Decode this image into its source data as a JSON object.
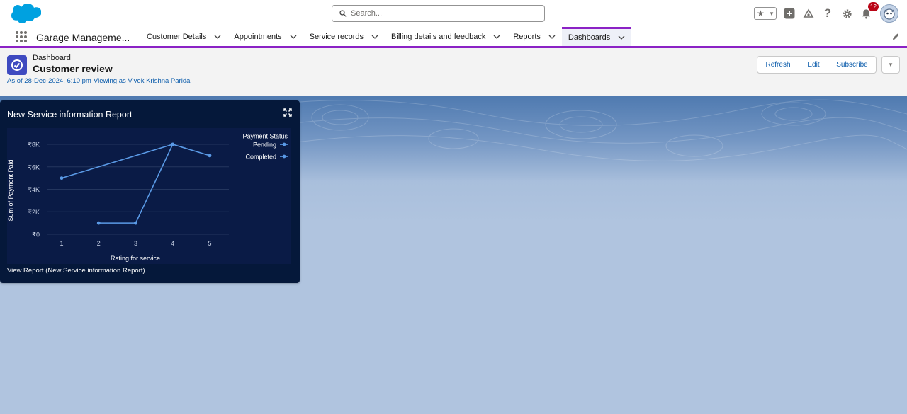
{
  "header": {
    "search_placeholder": "Search...",
    "notifications_count": "12"
  },
  "nav": {
    "app_name": "Garage Manageme...",
    "items": [
      {
        "label": "Customer Details"
      },
      {
        "label": "Appointments"
      },
      {
        "label": "Service records"
      },
      {
        "label": "Billing details and feedback"
      },
      {
        "label": "Reports"
      },
      {
        "label": "Dashboards"
      }
    ],
    "active_item": "Dashboards"
  },
  "page": {
    "object_type": "Dashboard",
    "title": "Customer review",
    "meta": "As of 28-Dec-2024, 6:10 pm·Viewing as Vivek Krishna Parida",
    "buttons": {
      "refresh": "Refresh",
      "edit": "Edit",
      "subscribe": "Subscribe"
    }
  },
  "widget": {
    "title": "New Service information Report",
    "view_report": "View Report (New Service information Report)"
  },
  "colors": {
    "brand_blue": "#00a1e0",
    "nav_accent": "#8b22c5",
    "link_blue": "#0b5cab",
    "widget_bg": "#05183a",
    "series_line": "#5a9ae6"
  },
  "chart_data": {
    "type": "line",
    "title": "New Service information Report",
    "xlabel": "Rating for service",
    "ylabel": "Sum of Payment Paid",
    "x": [
      1,
      2,
      3,
      4,
      5
    ],
    "y_ticks": [
      "₹0",
      "₹2K",
      "₹4K",
      "₹6K",
      "₹8K"
    ],
    "ylim": [
      0,
      8000
    ],
    "legend_title": "Payment Status",
    "legend_position": "top-right",
    "series": [
      {
        "name": "Pending",
        "points": [
          [
            2,
            1000
          ],
          [
            3,
            1000
          ],
          [
            4,
            8000
          ],
          [
            5,
            7000
          ]
        ]
      },
      {
        "name": "Completed",
        "points": [
          [
            1,
            5000
          ],
          [
            4,
            8000
          ]
        ]
      }
    ]
  }
}
